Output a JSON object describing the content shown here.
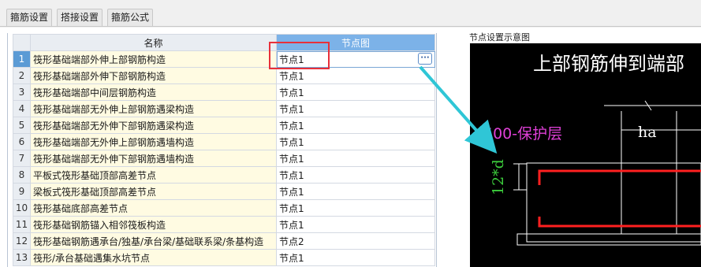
{
  "tabs": [
    {
      "label": "箍筋设置",
      "active": false
    },
    {
      "label": "搭接设置",
      "active": false
    },
    {
      "label": "箍筋公式",
      "active": false
    }
  ],
  "table": {
    "headers": {
      "name": "名称",
      "node": "节点图"
    },
    "rows": [
      {
        "num": "1",
        "name": "筏形基础端部外伸上部钢筋构造",
        "node": "节点1"
      },
      {
        "num": "2",
        "name": "筏形基础端部外伸下部钢筋构造",
        "node": "节点1"
      },
      {
        "num": "3",
        "name": "筏形基础端部中间层钢筋构造",
        "node": "节点1"
      },
      {
        "num": "4",
        "name": "筏形基础端部无外伸上部钢筋遇梁构造",
        "node": "节点1"
      },
      {
        "num": "5",
        "name": "筏形基础端部无外伸下部钢筋遇梁构造",
        "node": "节点1"
      },
      {
        "num": "6",
        "name": "筏形基础端部无外伸上部钢筋遇墙构造",
        "node": "节点1"
      },
      {
        "num": "7",
        "name": "筏形基础端部无外伸下部钢筋遇墙构造",
        "node": "节点1"
      },
      {
        "num": "8",
        "name": "平板式筏形基础顶部高差节点",
        "node": "节点1"
      },
      {
        "num": "9",
        "name": "梁板式筏形基础顶部高差节点",
        "node": "节点1"
      },
      {
        "num": "10",
        "name": "筏形基础底部高差节点",
        "node": "节点1"
      },
      {
        "num": "11",
        "name": "筏形基础钢筋锚入相邻筏板构造",
        "node": "节点1"
      },
      {
        "num": "12",
        "name": "筏形基础钢筋遇承台/独基/承台梁/基础联系梁/条基构造",
        "node": "节点2"
      },
      {
        "num": "13",
        "name": "筏形/承台基础遇集水坑节点",
        "node": "节点1"
      }
    ],
    "selected_row": 0,
    "ellipsis_label": "···"
  },
  "preview": {
    "title": "节点设置示意图",
    "diagram_title": "上部钢筋伸到端部",
    "label_cover": "500-保护层",
    "label_ha": "ha",
    "label_12d": "12*d"
  },
  "colors": {
    "red_highlight": "#e8303a",
    "arrow": "#2fc6d6",
    "header_blue": "#7cb2e8",
    "name_cell_bg": "#fffbe2",
    "magenta_label": "#e040d8",
    "green_label": "#3ccc3c",
    "rebar_red": "#ff2020"
  }
}
